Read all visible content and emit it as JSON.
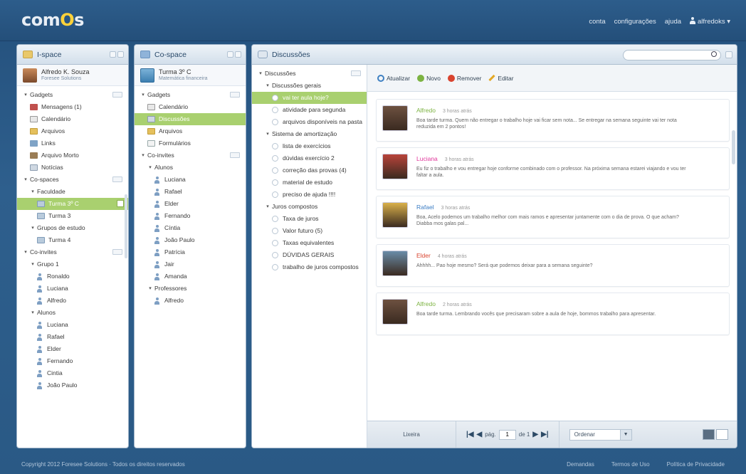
{
  "brand": {
    "logo": "comOs"
  },
  "topnav": {
    "conta": "conta",
    "config": "configurações",
    "ajuda": "ajuda",
    "user": "alfredoks"
  },
  "ispace": {
    "title": "I-space",
    "user_name": "Alfredo K. Souza",
    "user_org": "Foresee Solutions",
    "tree": [
      {
        "label": "Gadgets",
        "level": 0,
        "tog": "▾",
        "icon": "",
        "mini": true
      },
      {
        "label": "Mensagens (1)",
        "level": 1,
        "icon": "msg"
      },
      {
        "label": "Calendário",
        "level": 1,
        "icon": "cal"
      },
      {
        "label": "Arquivos",
        "level": 1,
        "icon": "fold"
      },
      {
        "label": "Links",
        "level": 1,
        "icon": "link"
      },
      {
        "label": "Arquivo Morto",
        "level": 1,
        "icon": "mural"
      },
      {
        "label": "Notícias",
        "level": 1,
        "icon": "news"
      },
      {
        "label": "Co-spaces",
        "level": 0,
        "tog": "▾",
        "mini": true
      },
      {
        "label": "Faculdade",
        "level": 1,
        "tog": "▾"
      },
      {
        "label": "Turma 3º C",
        "level": 2,
        "icon": "grp",
        "sel": true
      },
      {
        "label": "Turma 3",
        "level": 2,
        "icon": "grp"
      },
      {
        "label": "Grupos de estudo",
        "level": 1,
        "tog": "▾"
      },
      {
        "label": "Turma 4",
        "level": 2,
        "icon": "grp"
      },
      {
        "label": "Co-invites",
        "level": 0,
        "tog": "▾",
        "mini": true
      },
      {
        "label": "Grupo 1",
        "level": 1,
        "tog": "▾"
      },
      {
        "label": "Ronaldo",
        "level": 2,
        "icon": "person"
      },
      {
        "label": "Luciana",
        "level": 2,
        "icon": "person"
      },
      {
        "label": "Alfredo",
        "level": 2,
        "icon": "person"
      },
      {
        "label": "Alunos",
        "level": 1,
        "tog": "▾"
      },
      {
        "label": "Luciana",
        "level": 2,
        "icon": "person"
      },
      {
        "label": "Rafael",
        "level": 2,
        "icon": "person"
      },
      {
        "label": "Elder",
        "level": 2,
        "icon": "person"
      },
      {
        "label": "Fernando",
        "level": 2,
        "icon": "person"
      },
      {
        "label": "Cintia",
        "level": 2,
        "icon": "person"
      },
      {
        "label": "João Paulo",
        "level": 2,
        "icon": "person"
      }
    ]
  },
  "cospace": {
    "title": "Co-space",
    "course_name": "Turma 3º C",
    "course_sub": "Matemática financeira",
    "tree": [
      {
        "label": "Gadgets",
        "level": 0,
        "tog": "▾",
        "mini": true
      },
      {
        "label": "Calendário",
        "level": 1,
        "icon": "cal"
      },
      {
        "label": "Discussões",
        "level": 1,
        "icon": "news",
        "sel": true
      },
      {
        "label": "Arquivos",
        "level": 1,
        "icon": "fold"
      },
      {
        "label": "Formulários",
        "level": 1,
        "icon": "form"
      },
      {
        "label": "Co-invites",
        "level": 0,
        "tog": "▾",
        "mini": true
      },
      {
        "label": "Alunos",
        "level": 1,
        "tog": "▾"
      },
      {
        "label": "Luciana",
        "level": 2,
        "icon": "person"
      },
      {
        "label": "Rafael",
        "level": 2,
        "icon": "person"
      },
      {
        "label": "Elder",
        "level": 2,
        "icon": "person"
      },
      {
        "label": "Fernando",
        "level": 2,
        "icon": "person"
      },
      {
        "label": "Cíntia",
        "level": 2,
        "icon": "person"
      },
      {
        "label": "João Paulo",
        "level": 2,
        "icon": "person"
      },
      {
        "label": "Patrícia",
        "level": 2,
        "icon": "person"
      },
      {
        "label": "Jair",
        "level": 2,
        "icon": "person"
      },
      {
        "label": "Amanda",
        "level": 2,
        "icon": "person"
      },
      {
        "label": "Professores",
        "level": 1,
        "tog": "▾"
      },
      {
        "label": "Alfredo",
        "level": 2,
        "icon": "person"
      }
    ]
  },
  "discussoes": {
    "title": "Discussões",
    "search_placeholder": "",
    "tree": [
      {
        "label": "Discussões",
        "level": 0,
        "tog": "▾",
        "mini": true
      },
      {
        "label": "Discussões gerais",
        "level": 1,
        "tog": "▾"
      },
      {
        "label": "vai ter aula hoje?",
        "level": 2,
        "icon": "circ",
        "sel": true
      },
      {
        "label": "atividade para segunda",
        "level": 2,
        "icon": "circ"
      },
      {
        "label": "arquivos disponíveis na pasta",
        "level": 2,
        "icon": "circ"
      },
      {
        "label": "Sistema de amortização",
        "level": 1,
        "tog": "▾"
      },
      {
        "label": "lista de exercícios",
        "level": 2,
        "icon": "circ"
      },
      {
        "label": "dúvidas exercício 2",
        "level": 2,
        "icon": "circ"
      },
      {
        "label": "correção das provas (4)",
        "level": 2,
        "icon": "circ"
      },
      {
        "label": "material de estudo",
        "level": 2,
        "icon": "circ"
      },
      {
        "label": "preciso de ajuda !!!!",
        "level": 2,
        "icon": "circ"
      },
      {
        "label": "Juros compostos",
        "level": 1,
        "tog": "▾"
      },
      {
        "label": "Taxa de juros",
        "level": 2,
        "icon": "circ"
      },
      {
        "label": "Valor futuro (5)",
        "level": 2,
        "icon": "circ"
      },
      {
        "label": "Taxas equivalentes",
        "level": 2,
        "icon": "circ"
      },
      {
        "label": "DÚVIDAS GERAIS",
        "level": 2,
        "icon": "circ"
      },
      {
        "label": "trabalho de juros compostos",
        "level": 2,
        "icon": "circ"
      }
    ],
    "toolbar": {
      "refresh": "Atualizar",
      "new": "Novo",
      "remove": "Remover",
      "edit": "Editar"
    },
    "posts": [
      {
        "author": "Alfredo",
        "color": "#7cb342",
        "time": "3 horas atrás",
        "text": "Boa tarde turma. Quem não entregar o trabalho hoje vai ficar sem nota... Se entregar na semana seguinte vai ter nota reduzida em 2 pontos!",
        "pic": "#6d5140"
      },
      {
        "author": "Luciana",
        "color": "#e0359a",
        "time": "3 horas atrás",
        "text": "Eu fiz o trabalho e vou entregar hoje conforme combinado com o professor. Na próxima semana estarei viajando e vou ter faltar a aula.",
        "pic": "#b8433a"
      },
      {
        "author": "Rafael",
        "color": "#3b7dc4",
        "time": "3 horas atrás",
        "text": "Boa, Acelo podemos um trabalho melhor com mais ramos e apresentar juntamente com o dia de prova. O que acham? Diabba mos galas pal...",
        "pic": "#d9b04a"
      },
      {
        "author": "Elder",
        "color": "#d9442f",
        "time": "4 horas atrás",
        "text": "Ahhhh... Pao hoje mesmo? Será que podemos deixar para a semana seguinte?",
        "pic": "#6a8ca8"
      },
      {
        "author": "Alfredo",
        "color": "#7cb342",
        "time": "2 horas atrás",
        "text": "Boa tarde turma. Lembrando vocês que precisaram sobre a aula de hoje, bommos trabalho para apresentar.",
        "pic": "#6d5140"
      }
    ],
    "footer": {
      "label": "Lixeira",
      "page_label": "pág.",
      "page": "1",
      "of": "de 1",
      "sort": "Ordenar"
    }
  },
  "bottom": {
    "copyright": "Copyright 2012 Foresee Solutions · Todos os direitos reservados",
    "links": [
      "Demandas",
      "Termos de Uso",
      "Política de Privacidade"
    ]
  }
}
